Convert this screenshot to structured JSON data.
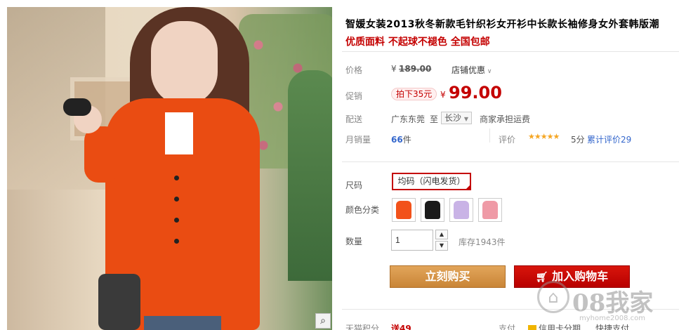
{
  "product": {
    "title": "智媛女装2013秋冬新款毛针织衫女开衫中长款长袖修身女外套韩版潮",
    "subtitle": "优质面料 不起球不褪色 全国包邮"
  },
  "price": {
    "label": "价格",
    "currency": "¥",
    "original": "189.00",
    "store_discount": "店铺优惠",
    "promo_label": "促销",
    "promo_pill": "拍下35元",
    "promo_price": "99.00"
  },
  "shipping": {
    "label": "配送",
    "from": "广东东莞",
    "to_word": "至",
    "to_city": "长沙",
    "note": "商家承担运费"
  },
  "sales": {
    "label": "月销量",
    "count": "66",
    "unit": "件",
    "rating_label": "评价",
    "stars": "★★★★★",
    "score": "5分",
    "review_link": "累计评价29"
  },
  "options": {
    "size_label": "尺码",
    "size_value": "均码（闪电发货）",
    "color_label": "颜色分类",
    "colors": [
      "#f2521a",
      "#1a1a1a",
      "#c9b3e6",
      "#ef9aa6"
    ]
  },
  "quantity": {
    "label": "数量",
    "value": "1",
    "stock": "库存1943件"
  },
  "actions": {
    "buy_now": "立刻购买",
    "add_cart": "加入购物车"
  },
  "bottom": {
    "points_label": "天猫积分",
    "points_value": "送49",
    "pay_label": "支付",
    "pay_value": "信用卡分期",
    "pay_note": "快捷支付"
  },
  "watermark": {
    "brand": "08我家",
    "url": "myhome2008.com"
  }
}
